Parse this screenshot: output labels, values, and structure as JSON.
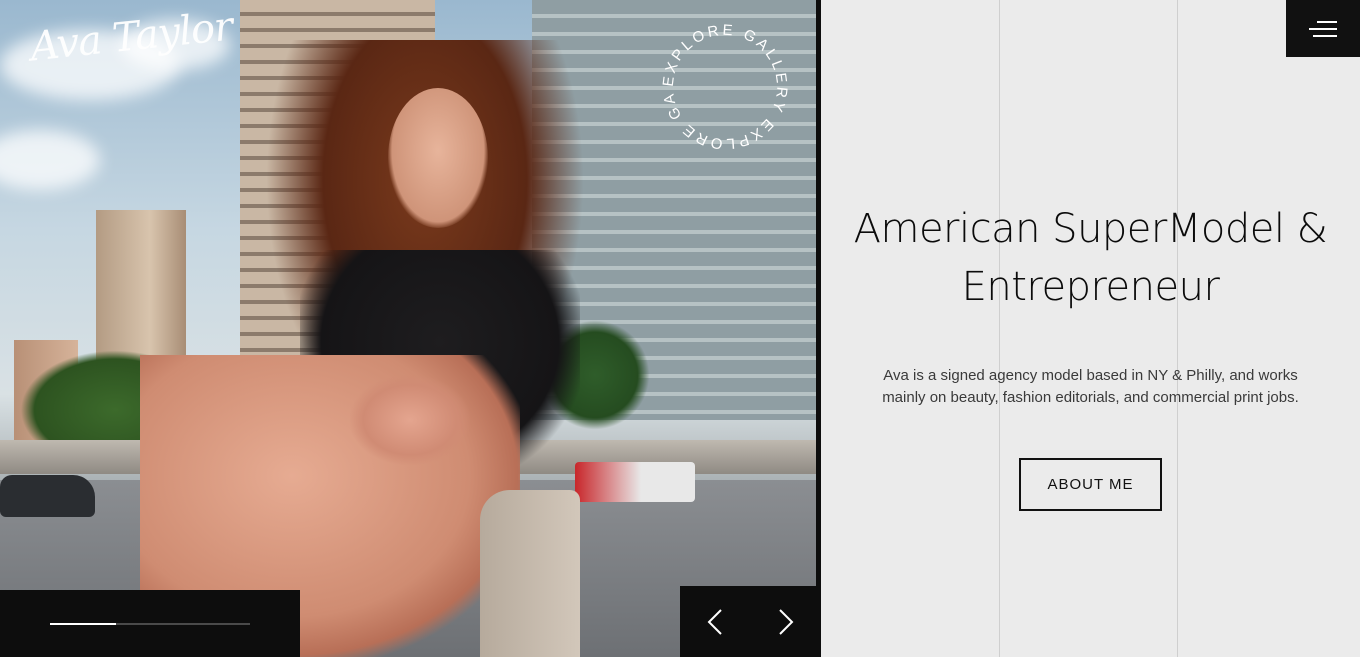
{
  "brand": {
    "logo_text": "Ava Taylor"
  },
  "hero": {
    "badge_text": "EXPLORE GALLERY EXPLORE GALLERY ",
    "slide_progress": 0.33
  },
  "nav": {
    "menu_icon": "hamburger-icon",
    "prev_icon": "chevron-left-icon",
    "next_icon": "chevron-right-icon"
  },
  "content": {
    "headline_line1": "American SuperModel &",
    "headline_line2": "Entrepreneur",
    "description_line1": "Ava is a signed agency model based in NY & Philly, and works",
    "description_line2": "mainly on beauty, fashion editorials, and commercial print jobs.",
    "about_button": "ABOUT ME"
  },
  "colors": {
    "dark": "#0d0d0d",
    "panel": "#ebebeb",
    "text": "#0b0b0b"
  }
}
